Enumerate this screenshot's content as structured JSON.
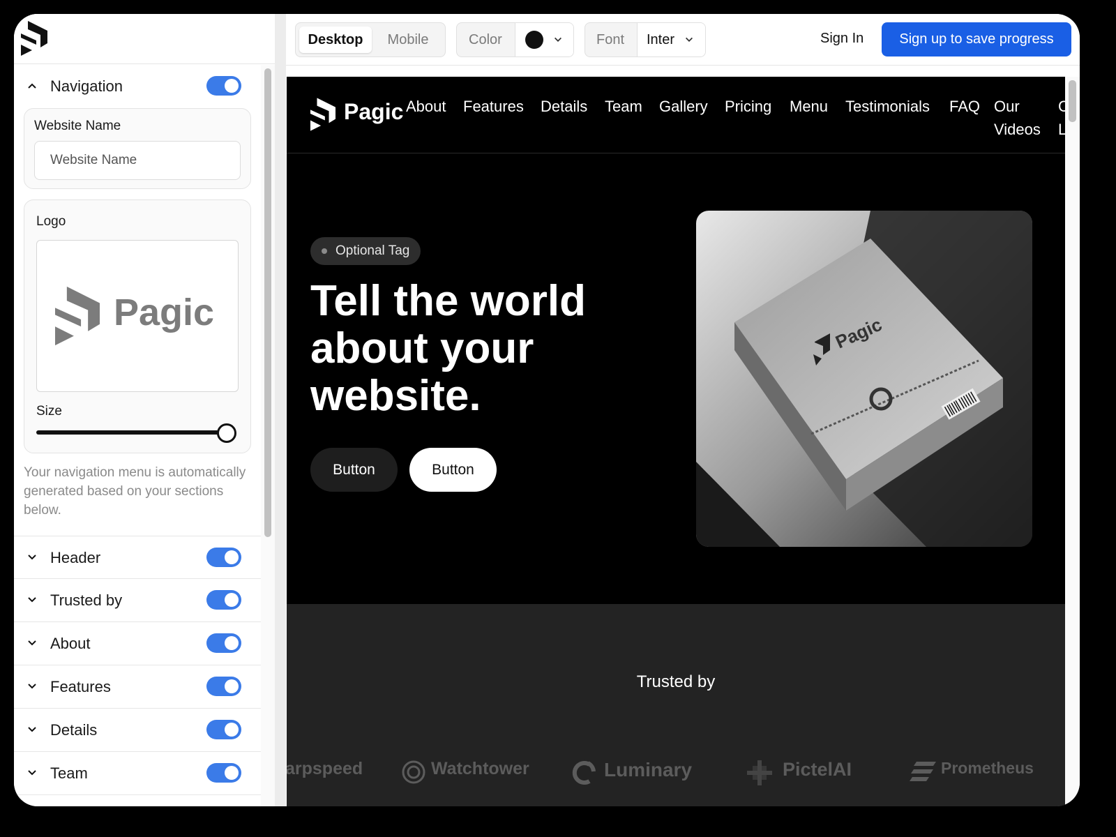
{
  "sidebar": {
    "nav_section": {
      "label": "Navigation"
    },
    "website_name": {
      "label": "Website Name",
      "placeholder": "Website Name"
    },
    "logo": {
      "label": "Logo",
      "brand": "Pagic",
      "size_label": "Size",
      "size_value": 1.0
    },
    "helper_text": "Your navigation menu is automatically generated based on your sections below.",
    "sections": [
      {
        "label": "Header",
        "enabled": true
      },
      {
        "label": "Trusted by",
        "enabled": true
      },
      {
        "label": "About",
        "enabled": true
      },
      {
        "label": "Features",
        "enabled": true
      },
      {
        "label": "Details",
        "enabled": true
      },
      {
        "label": "Team",
        "enabled": true
      }
    ]
  },
  "toolbar": {
    "view_modes": [
      "Desktop",
      "Mobile"
    ],
    "active_view": "Desktop",
    "color_label": "Color",
    "color_value": "#111111",
    "font_label": "Font",
    "font_value": "Inter",
    "sign_in": "Sign In",
    "sign_up": "Sign up to save progress"
  },
  "site": {
    "brand": "Pagic",
    "nav_links": [
      "About",
      "Features",
      "Details",
      "Team",
      "Gallery",
      "Pricing",
      "Menu",
      "Testimonials",
      "FAQ",
      "Our\nVideos",
      "C\nL"
    ],
    "tag": "Optional Tag",
    "headline": "Tell the world about your website.",
    "button_primary": "Button",
    "button_secondary": "Button",
    "hero_box_brand": "Pagic",
    "trusted_title": "Trusted by",
    "trusted_logos": [
      "arpspeed",
      "Watchtower",
      "Luminary",
      "PictelAI",
      "Prometheus"
    ]
  },
  "colors": {
    "accent": "#1a5fe5",
    "toggle": "#3b7be8"
  }
}
